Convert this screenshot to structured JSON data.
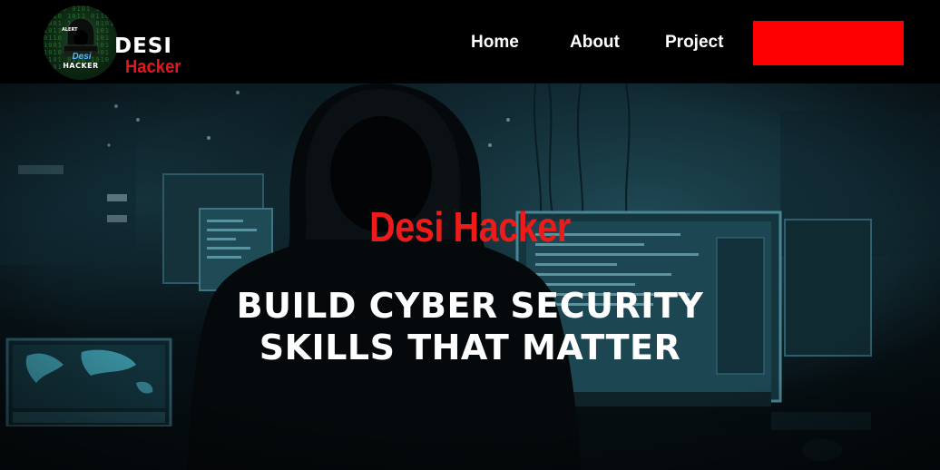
{
  "navbar": {
    "logo": {
      "badge_top": "ALERT",
      "badge_desi": "Desi",
      "badge_hacker": "HACKER",
      "wordmark_desi": "DESI",
      "wordmark_hacker": "Hacker"
    },
    "links": [
      {
        "label": "Home"
      },
      {
        "label": "About"
      },
      {
        "label": "Project"
      }
    ],
    "cta_label": ""
  },
  "hero": {
    "brand": "Desi Hacker",
    "headline_line1": "BUILD CYBER SECURITY",
    "headline_line2": "SKILLS THAT MATTER"
  },
  "colors": {
    "nav_background": "#000000",
    "accent_red": "#ff0000",
    "brand_red": "#ee1b1b",
    "text_white": "#ffffff",
    "hero_teal": "#1f4a56"
  },
  "icons": {
    "logo": "hooded-hacker-logo-icon"
  }
}
